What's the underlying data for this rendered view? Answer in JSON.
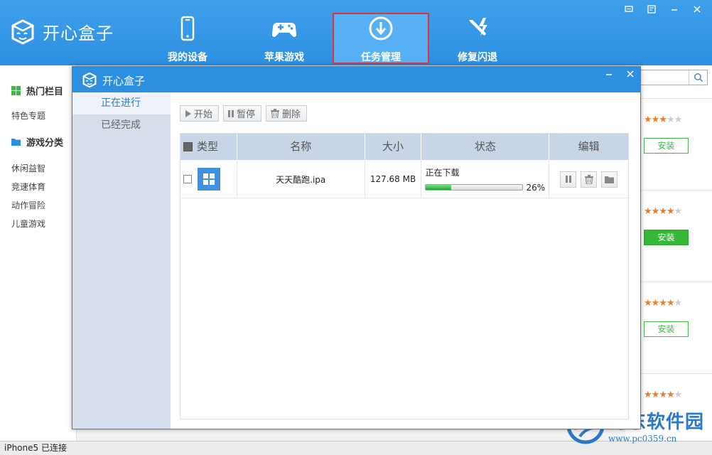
{
  "app": {
    "name": "开心盒子"
  },
  "window_controls": [
    "feedback",
    "skin",
    "minimize",
    "close"
  ],
  "nav": [
    {
      "label": "我的设备",
      "icon": "phone-icon"
    },
    {
      "label": "苹果游戏",
      "icon": "gamepad-icon"
    },
    {
      "label": "任务管理",
      "icon": "download-icon",
      "active": true
    },
    {
      "label": "修复闪退",
      "icon": "repair-icon"
    }
  ],
  "sidebar": {
    "sections": [
      {
        "title": "热门栏目",
        "icon": "grid-icon",
        "items": [
          "特色专题"
        ]
      },
      {
        "title": "游戏分类",
        "icon": "folder-icon",
        "items": [
          "休闲益智",
          "竞速体育",
          "动作冒险",
          "儿童游戏"
        ]
      }
    ]
  },
  "apps": [
    {
      "rating": 3,
      "install_label": "安装",
      "filled": false
    },
    {
      "rating": 4,
      "install_label": "安装",
      "filled": true
    },
    {
      "rating": 4,
      "install_label": "安装",
      "filled": false
    },
    {
      "rating": 4
    }
  ],
  "status_bar": {
    "text": "iPhone5 已连接"
  },
  "watermark": {
    "title": "河东软件园",
    "url": "www.pc0359.cn"
  },
  "dialog": {
    "title": "开心盒子",
    "tabs": [
      {
        "label": "正在进行",
        "active": true
      },
      {
        "label": "已经完成",
        "active": false
      }
    ],
    "toolbar": {
      "start": "开始",
      "pause": "暂停",
      "delete": "删除"
    },
    "table": {
      "headers": {
        "type": "类型",
        "name": "名称",
        "size": "大小",
        "status": "状态",
        "edit": "编辑"
      },
      "rows": [
        {
          "name": "天天酷跑.ipa",
          "size": "127.68 MB",
          "status": "正在下载",
          "progress": 0.26,
          "progress_label": "26%"
        }
      ]
    }
  },
  "colors": {
    "primary": "#2d8fe0",
    "nav_active_border": "#e0323a",
    "install_green": "#36b738",
    "star": "#f07c2a",
    "table_header": "#c7d5e7",
    "dialog_sidebar": "#d5deea"
  }
}
